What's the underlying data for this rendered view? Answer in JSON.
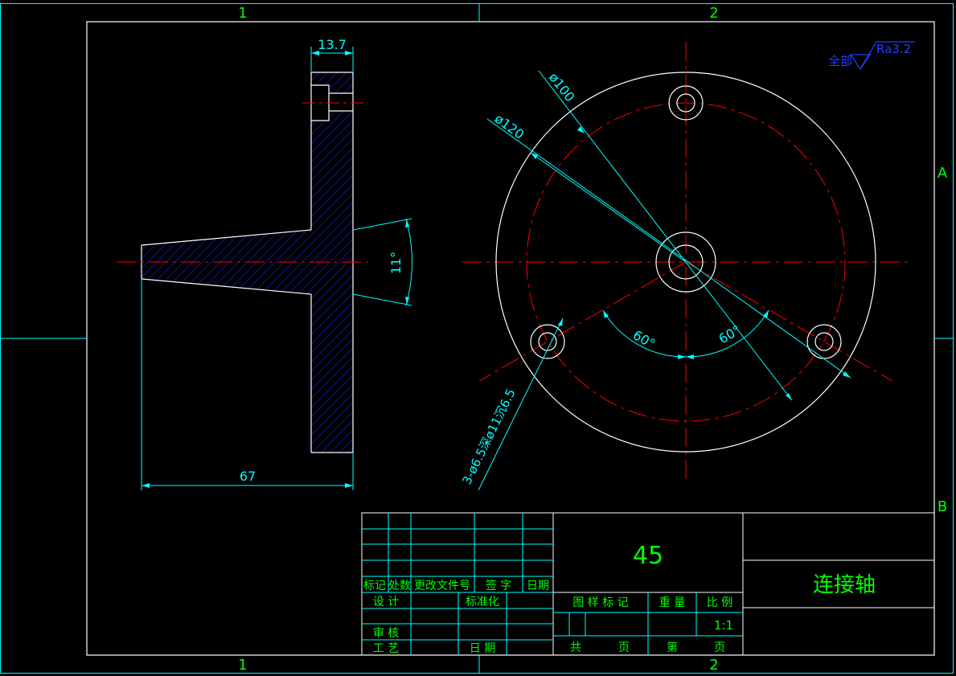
{
  "frame": {
    "zone_cols": [
      "1",
      "2"
    ],
    "zone_rows": [
      "A",
      "B"
    ]
  },
  "roughness": {
    "prefix": "全部",
    "value": "Ra3.2"
  },
  "section_view": {
    "dim_thickness": "13.7",
    "dim_length": "67",
    "dim_angle": "11°"
  },
  "plan_view": {
    "dim_d100": "ø100",
    "dim_d120": "ø120",
    "dim_holes": "3-ø6.5深ø11沉6.5",
    "angle_left": "60°",
    "angle_right": "60°"
  },
  "title_block": {
    "material": "45",
    "part_name": "连接轴",
    "rev_headers": [
      "标记",
      "处数",
      "更改文件号",
      "签 字",
      "日期"
    ],
    "design": "设 计",
    "standardize": "标准化",
    "review": "审 核",
    "process": "工 艺",
    "date": "日 期",
    "stage_mark": "图 样 标 记",
    "weight": "重 量",
    "scale_label": "比 例",
    "scale_value": "1:1",
    "total": "共",
    "sheet_unit1": "页",
    "sheet_no": "第",
    "sheet_unit2": "页"
  },
  "colors": {
    "frame": "#00ffff",
    "outline": "#ffffff",
    "centerline": "#ff0000",
    "dimension": "#00ffff",
    "hatch": "#2020ff",
    "text": "#00ff00",
    "roughness": "#2040ff"
  }
}
